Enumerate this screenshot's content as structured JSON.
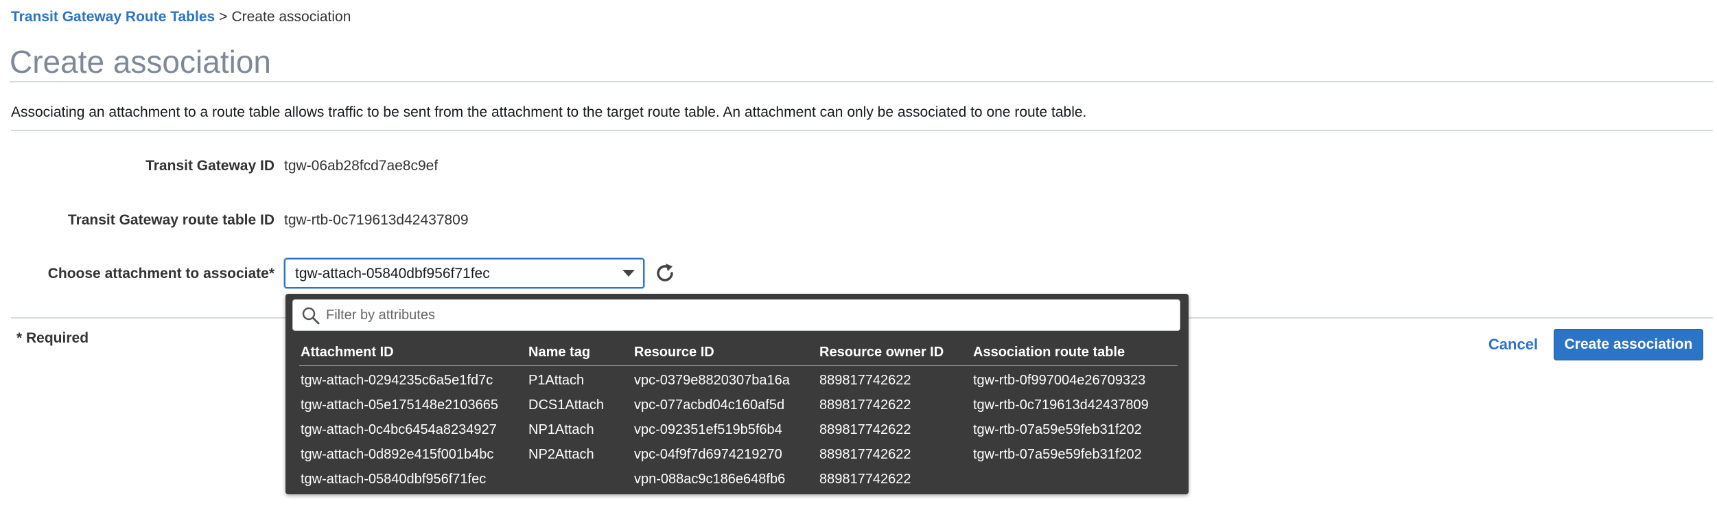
{
  "breadcrumb": {
    "parent": "Transit Gateway Route Tables",
    "separator": ">",
    "current": "Create association"
  },
  "page": {
    "title": "Create association",
    "description": "Associating an attachment to a route table allows traffic to be sent from the attachment to the target route table. An attachment can only be associated to one route table."
  },
  "form": {
    "tgw_id_label": "Transit Gateway ID",
    "tgw_id_value": "tgw-06ab28fcd7ae8c9ef",
    "rtb_id_label": "Transit Gateway route table ID",
    "rtb_id_value": "tgw-rtb-0c719613d42437809",
    "attachment_label": "Choose attachment to associate*",
    "attachment_selected": "tgw-attach-05840dbf956f71fec",
    "refresh_icon": "refresh-icon",
    "required_note": "* Required"
  },
  "dropdown": {
    "filter_placeholder": "Filter by attributes",
    "search_icon": "search-icon",
    "columns": [
      "Attachment ID",
      "Name tag",
      "Resource ID",
      "Resource owner ID",
      "Association route table"
    ],
    "rows": [
      [
        "tgw-attach-0294235c6a5e1fd7c",
        "P1Attach",
        "vpc-0379e8820307ba16a",
        "889817742622",
        "tgw-rtb-0f997004e26709323"
      ],
      [
        "tgw-attach-05e175148e2103665",
        "DCS1Attach",
        "vpc-077acbd04c160af5d",
        "889817742622",
        "tgw-rtb-0c719613d42437809"
      ],
      [
        "tgw-attach-0c4bc6454a8234927",
        "NP1Attach",
        "vpc-092351ef519b5f6b4",
        "889817742622",
        "tgw-rtb-07a59e59feb31f202"
      ],
      [
        "tgw-attach-0d892e415f001b4bc",
        "NP2Attach",
        "vpc-04f9f7d6974219270",
        "889817742622",
        "tgw-rtb-07a59e59feb31f202"
      ],
      [
        "tgw-attach-05840dbf956f71fec",
        "",
        "vpn-088ac9c186e648fb6",
        "889817742622",
        ""
      ]
    ]
  },
  "actions": {
    "cancel": "Cancel",
    "create": "Create association"
  },
  "colors": {
    "accent": "#2b74c6",
    "dropdown_bg": "#3b3b3b",
    "title_gray": "#7d8998"
  }
}
